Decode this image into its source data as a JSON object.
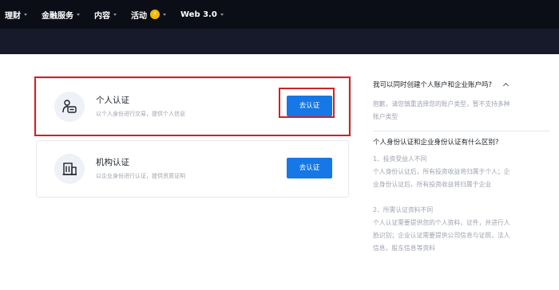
{
  "nav": {
    "items": [
      {
        "label": "理财"
      },
      {
        "label": "金融服务"
      },
      {
        "label": "内容"
      },
      {
        "label": "活动"
      },
      {
        "label": "Web 3.0"
      }
    ],
    "activity_badge": "⚡"
  },
  "cards": [
    {
      "title": "个人认证",
      "description": "以个人身份进行交易，提供个人信息",
      "button": "去认证",
      "icon": "user-id-card-icon"
    },
    {
      "title": "机构认证",
      "description": "以企业身份进行认证，提供资质证明",
      "button": "去认证",
      "icon": "building-icon"
    }
  ],
  "faq": [
    {
      "question": "我可以同时创建个人账户和企业账户吗?",
      "answer_lines": [
        "抱歉，请您慎重选择您的账户类型，暂不支持多种",
        "账户类型"
      ]
    },
    {
      "question": "个人身份认证和企业身份认证有什么区别?",
      "answer_lines": [
        "1、投资受益人不同",
        "个人身份认证后，所有投资收益将归属于个人；企",
        "业身份认证后，所有投资收益将归属于企业",
        "",
        "2、所需认证资料不同",
        "个人认证需要提供您的个人资料，证件，并进行人",
        "脸识别；企业认证需要提供公司信息与证照，法人",
        "信息，股东信息等资料"
      ]
    }
  ]
}
